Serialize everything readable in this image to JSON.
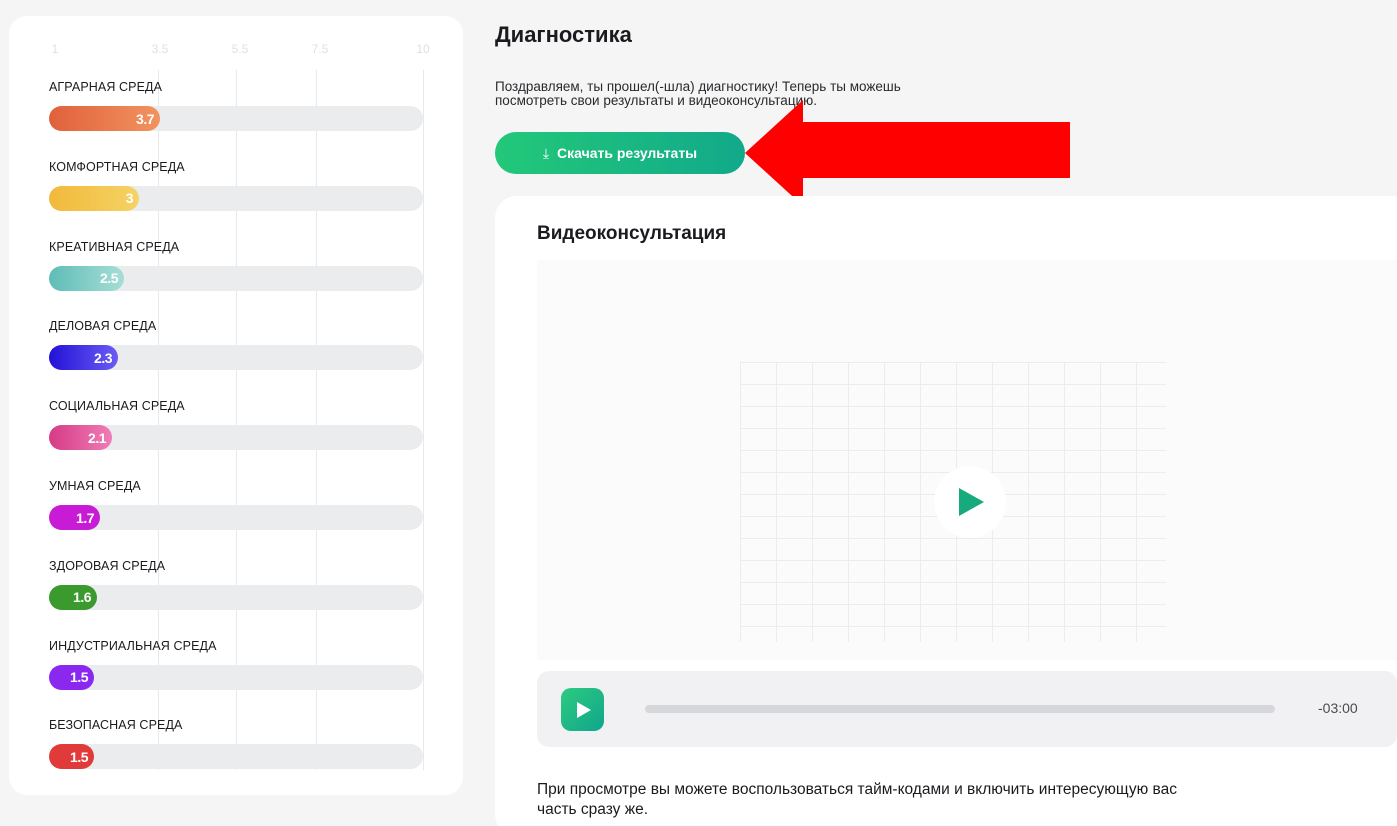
{
  "chart_data": {
    "type": "bar",
    "orientation": "horizontal",
    "x_ticks": [
      "1",
      "3.5",
      "5.5",
      "7.5",
      "10"
    ],
    "xlim": [
      1,
      10
    ],
    "categories": [
      "АГРАРНАЯ СРЕДА",
      "КОМФОРТНАЯ СРЕДА",
      "КРЕАТИВНАЯ СРЕДА",
      "ДЕЛОВАЯ СРЕДА",
      "СОЦИАЛЬНАЯ СРЕДА",
      "УМНАЯ СРЕДА",
      "ЗДОРОВАЯ СРЕДА",
      "ИНДУСТРИАЛЬНАЯ СРЕДА",
      "БЕЗОПАСНАЯ СРЕДА"
    ],
    "values": [
      3.7,
      3,
      2.5,
      2.3,
      2.1,
      1.7,
      1.6,
      1.5,
      1.5
    ],
    "value_labels": [
      "3.7",
      "3",
      "2.5",
      "2.3",
      "2.1",
      "1.7",
      "1.6",
      "1.5",
      "1.5"
    ],
    "bar_colors": [
      [
        "#e0613c",
        "#f2935f"
      ],
      [
        "#f2b93b",
        "#f5d365"
      ],
      [
        "#5fbdb7",
        "#a6ded6"
      ],
      [
        "#2212d6",
        "#6b5cf5"
      ],
      [
        "#d63b86",
        "#f07cb6"
      ],
      [
        "#c81bd6",
        "#c81bd6"
      ],
      [
        "#3a9a2e",
        "#3a9a2e"
      ],
      [
        "#8a28f0",
        "#8a28f0"
      ],
      [
        "#e03a3a",
        "#e03a3a"
      ]
    ],
    "grid": true
  },
  "header": {
    "title": "Диагностика",
    "intro_line1": "Поздравляем, ты прошел(-шла) диагностику! Теперь ты можешь",
    "intro_line2": "посмотреть свои результаты и видеоконсультацию."
  },
  "download": {
    "label": "Скачать результаты",
    "icon": "download-icon"
  },
  "annotation": {
    "color": "#ff0000"
  },
  "video": {
    "title": "Видеоконсультация",
    "time": "-03:00",
    "footnote_line1": "При просмотре вы можете воспользоваться тайм-кодами и включить интересующую вас",
    "footnote_line2": "часть сразу же."
  },
  "colors": {
    "accent": "#1db980",
    "background": "#f5f5f6"
  }
}
